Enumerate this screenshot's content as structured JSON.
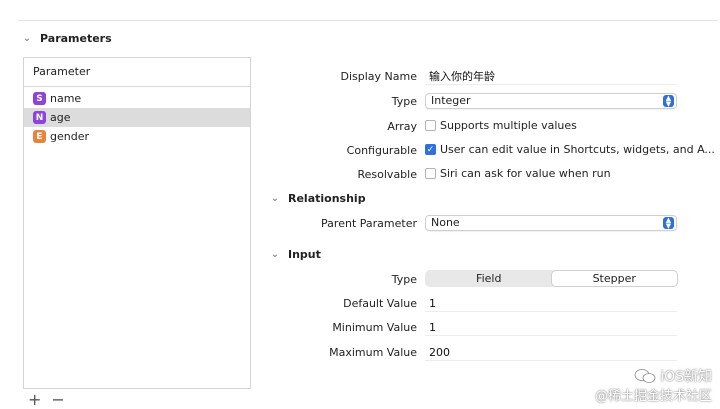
{
  "sections": {
    "parameters": "Parameters",
    "relationship": "Relationship",
    "input": "Input"
  },
  "parameter_list": {
    "header": "Parameter",
    "items": [
      {
        "badge": "S",
        "name": "name",
        "color": "#8e44d9"
      },
      {
        "badge": "N",
        "name": "age",
        "color": "#8e44d9"
      },
      {
        "badge": "E",
        "name": "gender",
        "color": "#e8853d"
      }
    ],
    "selected_index": 1
  },
  "bottom_controls": {
    "add": "+",
    "remove": "−"
  },
  "details": {
    "display_name_label": "Display Name",
    "display_name_value": "输入你的年龄",
    "type_label": "Type",
    "type_value": "Integer",
    "array_label": "Array",
    "array_checkbox": "Supports multiple values",
    "configurable_label": "Configurable",
    "configurable_checkbox": "User can edit value in Shortcuts, widgets, and A...",
    "resolvable_label": "Resolvable",
    "resolvable_checkbox": "Siri can ask for value when run"
  },
  "relationship": {
    "parent_label": "Parent Parameter",
    "parent_value": "None"
  },
  "input": {
    "type_label": "Type",
    "type_options": [
      "Field",
      "Stepper"
    ],
    "selected_type": "Stepper",
    "default_label": "Default Value",
    "default_value": "1",
    "minimum_label": "Minimum Value",
    "minimum_value": "1",
    "maximum_label": "Maximum Value",
    "maximum_value": "200"
  },
  "watermark": {
    "line1": "iOS新知",
    "line2": "@稀土掘金技术社区"
  },
  "colors": {
    "accent": "#2f6fde"
  }
}
